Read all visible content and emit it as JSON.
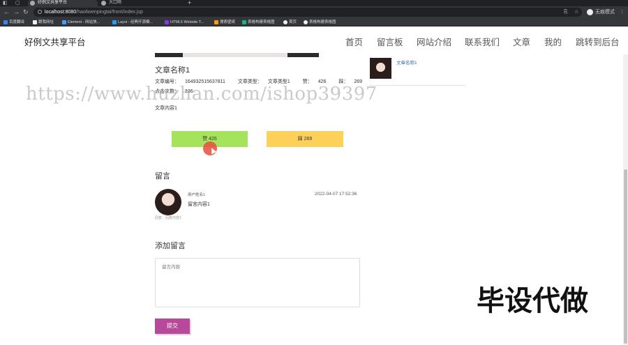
{
  "browser": {
    "tabs": [
      {
        "title": "好例文共享平台"
      },
      {
        "title": "大口吻"
      }
    ],
    "new_tab_icon": "plus-icon",
    "url_host": "localhost:8080",
    "url_path": "/haoliwenpingtai/front/index.jsp",
    "profile_label": "无痕模式",
    "bookmarks": [
      {
        "label": "百度翻译",
        "color": "#3b82f6"
      },
      {
        "label": "跟我网址",
        "color": "#eeeeee"
      },
      {
        "label": "Element - 网站快...",
        "color": "#409eff"
      },
      {
        "label": "Layui - 经典开源模...",
        "color": "#1e9fff"
      },
      {
        "label": "HTML5 Website T...",
        "color": "#7c3aed"
      },
      {
        "label": "搜索壁纸",
        "color": "#f59e0b"
      },
      {
        "label": "表格构建表格图",
        "color": "#10b981"
      },
      {
        "label": "首页",
        "color": "#eeeeee"
      },
      {
        "label": "表格构建表格图",
        "color": "#eeeeee"
      }
    ]
  },
  "header": {
    "site_title": "好例文共享平台",
    "nav": [
      "首页",
      "留言板",
      "网站介绍",
      "联系我们",
      "文章",
      "我的",
      "跳转到后台"
    ]
  },
  "article": {
    "title": "文章名称1",
    "number_label": "文章编号：",
    "number": "164932515637811",
    "type_label": "文章类型：",
    "type": "文章类型1",
    "likes_label": "赞：",
    "likes": "426",
    "dislikes_label": "踩：",
    "dislikes": "269",
    "clicks_label": "点击次数：",
    "clicks": "236",
    "content": "文章内容1",
    "like_button": "赞  426",
    "dislike_button": "踩  269"
  },
  "comments": {
    "section_title": "留言",
    "items": [
      {
        "user": "用户姓名1",
        "time": "2022-04-07 17:52:36",
        "content": "留言内容1",
        "reply": "回复：回复内容1"
      }
    ]
  },
  "add_comment": {
    "section_title": "添加留言",
    "placeholder": "留言内容",
    "submit_label": "提交"
  },
  "sidebar": {
    "related": [
      {
        "title": "文章名称1"
      }
    ]
  },
  "overlays": {
    "watermark": "https://www.huzhan.com/ishop39397",
    "promo": "毕设代做"
  },
  "colors": {
    "like": "#a6e35d",
    "dislike": "#fcd059",
    "submit": "#b7499a",
    "link": "#3a6fb0"
  }
}
